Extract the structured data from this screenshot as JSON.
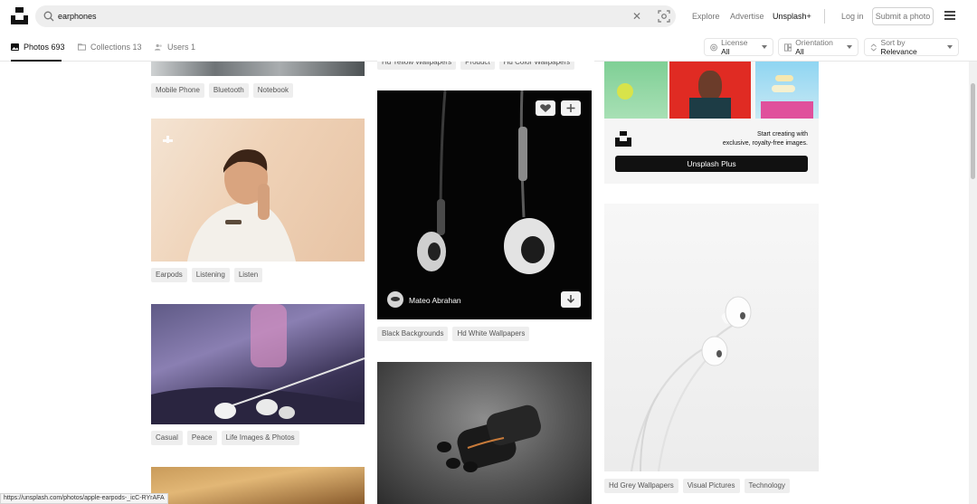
{
  "search": {
    "query": "earphones"
  },
  "nav": {
    "explore": "Explore",
    "advertise": "Advertise",
    "plus": "Unsplash+",
    "login": "Log in",
    "submit": "Submit a photo"
  },
  "tabs": [
    {
      "label": "Photos 693"
    },
    {
      "label": "Collections 13"
    },
    {
      "label": "Users 1"
    }
  ],
  "filters": {
    "license_prefix": "License",
    "license_value": "All",
    "orientation_prefix": "Orientation",
    "orientation_value": "All",
    "sort_prefix": "Sort by",
    "sort_value": "Relevance"
  },
  "col1": {
    "tags_a": [
      "Mobile Phone",
      "Bluetooth",
      "Notebook"
    ],
    "tags_b": [
      "Earpods",
      "Listening",
      "Listen"
    ],
    "tags_c": [
      "Casual",
      "Peace",
      "Life Images & Photos"
    ]
  },
  "col2": {
    "tags_top": [
      "Hd Yellow Wallpapers",
      "Product",
      "Hd Color Wallpapers"
    ],
    "author": "Mateo Abrahan",
    "tags_b": [
      "Black Backgrounds",
      "Hd White Wallpapers"
    ]
  },
  "col3": {
    "promo_text_line1": "Start creating with",
    "promo_text_line2": "exclusive, royalty-free images.",
    "promo_button": "Unsplash Plus",
    "tags_b": [
      "Hd Grey Wallpapers",
      "Visual Pictures",
      "Technology"
    ]
  },
  "statusbar": {
    "url": "https://unsplash.com/photos/apple-earpods-_icC-RYrAFA"
  },
  "colors": {
    "accent": "#111111",
    "tag_bg": "#eeeeee",
    "muted": "#767676"
  }
}
